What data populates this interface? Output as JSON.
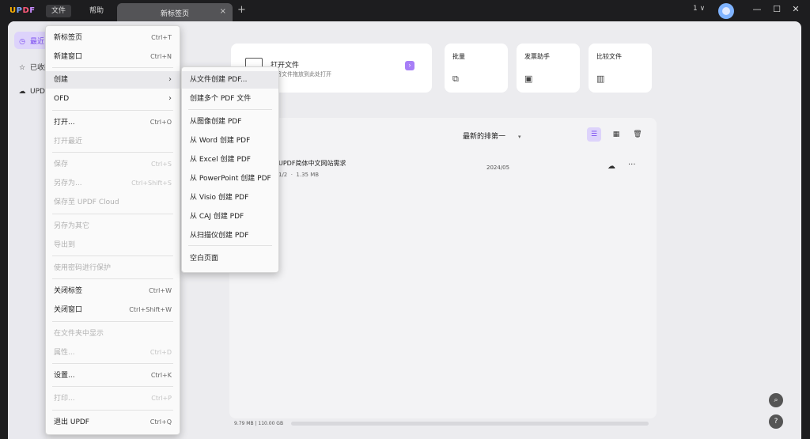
{
  "titlebar": {
    "logo": "UPDF",
    "menus": [
      "文件",
      "帮助"
    ],
    "tab_title": "新标签页",
    "tab_close": "×",
    "new_tab": "+",
    "count": "1",
    "count_caret": "∨"
  },
  "sidebar": {
    "items": [
      {
        "label": "最近",
        "icon": "clock-icon",
        "glyph": "◷"
      },
      {
        "label": "已收藏",
        "icon": "star-icon",
        "glyph": "☆"
      },
      {
        "label": "UPDF Cloud",
        "icon": "cloud-icon",
        "glyph": "☁"
      }
    ]
  },
  "cards": {
    "open": {
      "title": "打开文件",
      "subtitle": "或将文件拖放到此处打开",
      "arrow": "›"
    },
    "batch": {
      "title": "批量",
      "glyph": "⧉"
    },
    "invoice": {
      "title": "发票助手",
      "glyph": "▣"
    },
    "compare": {
      "title": "比较文件",
      "glyph": "▥"
    }
  },
  "panel": {
    "sort_label": "最新的排第一",
    "sort_caret": "▾",
    "view_list_glyph": "☰",
    "view_grid_glyph": "▦",
    "delete_glyph": "🗑",
    "file": {
      "name": "UPDF简体中文网站需求",
      "pages": "1/2",
      "size": "1.35 MB",
      "date": "2024/05",
      "cloud_glyph": "☁",
      "more_glyph": "···"
    }
  },
  "storage": {
    "text": "9.79 MB | 110.00 GB",
    "fraction": 0.0001
  },
  "fabs": {
    "search_glyph": "⌕",
    "help_glyph": "?"
  },
  "file_menu": {
    "items": [
      {
        "label": "新标签页",
        "shortcut": "Ctrl+T",
        "disabled": false
      },
      {
        "label": "新建窗口",
        "shortcut": "Ctrl+N",
        "disabled": false
      },
      {
        "label": "创建",
        "shortcut": "",
        "disabled": false,
        "submenu": true
      },
      {
        "label": "OFD",
        "shortcut": "",
        "disabled": false,
        "submenu": true
      },
      {
        "label": "打开...",
        "shortcut": "Ctrl+O",
        "disabled": false
      },
      {
        "label": "打开最近",
        "shortcut": "",
        "disabled": true
      },
      {
        "label": "保存",
        "shortcut": "Ctrl+S",
        "disabled": true
      },
      {
        "label": "另存为...",
        "shortcut": "Ctrl+Shift+S",
        "disabled": true
      },
      {
        "label": "保存至 UPDF Cloud",
        "shortcut": "",
        "disabled": true
      },
      {
        "label": "另存为其它",
        "shortcut": "",
        "disabled": true
      },
      {
        "label": "导出到",
        "shortcut": "",
        "disabled": true
      },
      {
        "label": "使用密码进行保护",
        "shortcut": "",
        "disabled": true
      },
      {
        "label": "关闭标签",
        "shortcut": "Ctrl+W",
        "disabled": false
      },
      {
        "label": "关闭窗口",
        "shortcut": "Ctrl+Shift+W",
        "disabled": false
      },
      {
        "label": "在文件夹中显示",
        "shortcut": "",
        "disabled": true
      },
      {
        "label": "属性...",
        "shortcut": "Ctrl+D",
        "disabled": true
      },
      {
        "label": "设置...",
        "shortcut": "Ctrl+K",
        "disabled": false
      },
      {
        "label": "打印...",
        "shortcut": "Ctrl+P",
        "disabled": true
      },
      {
        "label": "退出 UPDF",
        "shortcut": "Ctrl+Q",
        "disabled": false
      }
    ]
  },
  "create_menu": {
    "items": [
      "从文件创建 PDF...",
      "创建多个 PDF 文件",
      "从图像创建 PDF",
      "从 Word 创建 PDF",
      "从 Excel 创建 PDF",
      "从 PowerPoint 创建 PDF",
      "从 Visio 创建 PDF",
      "从 CAJ 创建 PDF",
      "从扫描仪创建 PDF",
      "空白页面"
    ]
  }
}
